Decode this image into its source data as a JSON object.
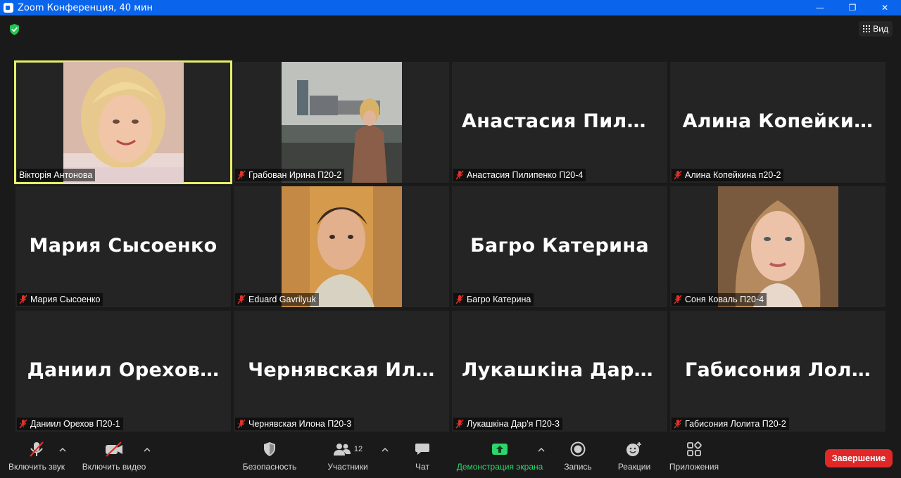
{
  "window": {
    "title": "Zoom Конференция, 40 мин",
    "minimize": "—",
    "maximize": "❐",
    "close": "✕"
  },
  "top": {
    "view_label": "Вид"
  },
  "participants": [
    {
      "tile_name": "",
      "label": "Вікторія Антонова",
      "muted": false,
      "video": true,
      "active": true
    },
    {
      "tile_name": "",
      "label": "Грабован Ирина П20-2",
      "muted": true,
      "video": true,
      "active": false
    },
    {
      "tile_name": "Анастасия  Пили…",
      "label": "Анастасия Пилипенко П20-4",
      "muted": true,
      "video": false,
      "active": false
    },
    {
      "tile_name": "Алина  Копейки…",
      "label": "Алина Копейкина п20-2",
      "muted": true,
      "video": false,
      "active": false
    },
    {
      "tile_name": "Мария Сысоенко",
      "label": "Мария Сысоенко",
      "muted": true,
      "video": false,
      "active": false
    },
    {
      "tile_name": "",
      "label": "Eduard Gavrilyuk",
      "muted": true,
      "video": true,
      "active": false
    },
    {
      "tile_name": "Багро Катерина",
      "label": "Багро Катерина",
      "muted": true,
      "video": false,
      "active": false
    },
    {
      "tile_name": "",
      "label": "Соня Коваль П20-4",
      "muted": true,
      "video": true,
      "active": false
    },
    {
      "tile_name": "Даниил  Орехов…",
      "label": "Даниил Орехов П20-1",
      "muted": true,
      "video": false,
      "active": false
    },
    {
      "tile_name": "Чернявская  Ил…",
      "label": "Чернявская Илона П20-3",
      "muted": true,
      "video": false,
      "active": false
    },
    {
      "tile_name": "Лукашкіна  Дар'…",
      "label": "Лукашкіна Дар'я П20-3",
      "muted": true,
      "video": false,
      "active": false
    },
    {
      "tile_name": "Габисония  Лол…",
      "label": "Габисония Лолита  П20-2",
      "muted": true,
      "video": false,
      "active": false
    }
  ],
  "toolbar": {
    "audio": "Включить звук",
    "video": "Включить видео",
    "security": "Безопасность",
    "participants": "Участники",
    "participants_count": "12",
    "chat": "Чат",
    "share": "Демонстрация экрана",
    "record": "Запись",
    "reactions": "Реакции",
    "apps": "Приложения",
    "end": "Завершение"
  },
  "colors": {
    "titlebar": "#0a64ec",
    "active_speaker": "#e8f06a",
    "share_green": "#2bd66a",
    "end_red": "#e02828",
    "muted_red": "#e0322b"
  }
}
